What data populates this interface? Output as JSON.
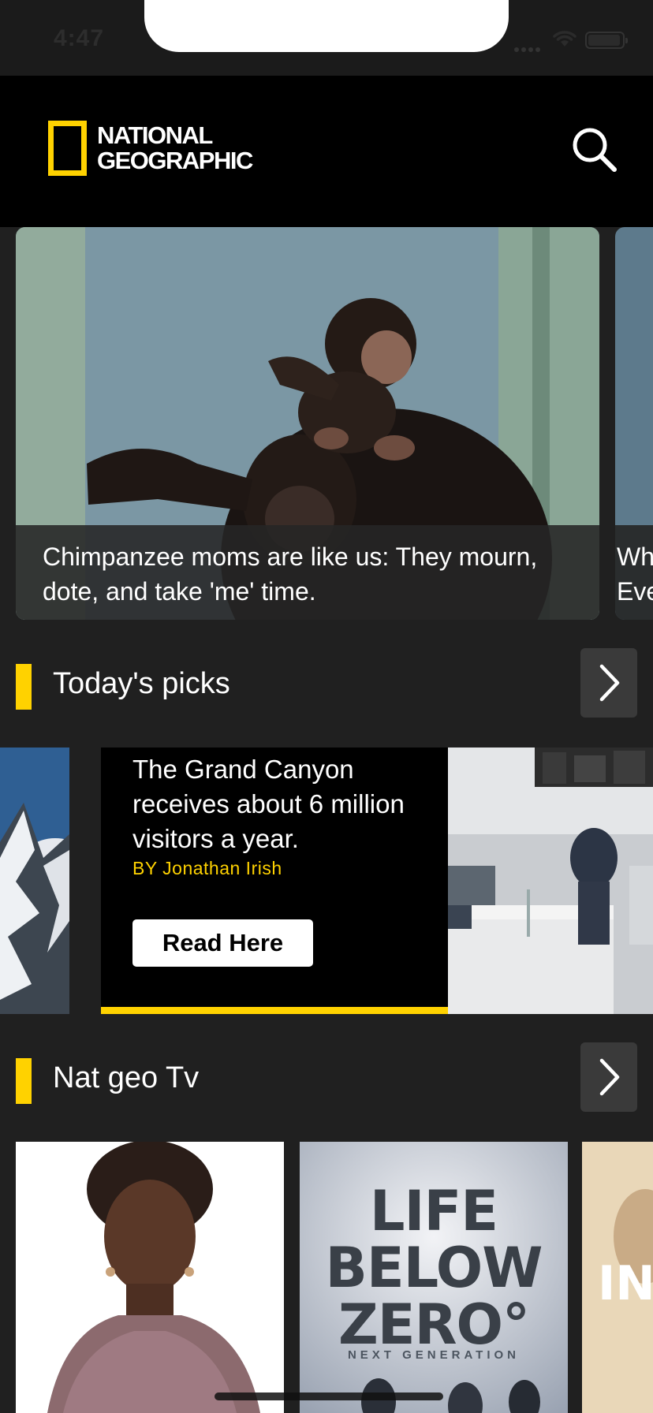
{
  "status_bar": {
    "time": "4:47"
  },
  "header": {
    "logo_line1": "NATIONAL",
    "logo_line2": "GEOGRAPHIC",
    "accent_color": "#ffd200"
  },
  "hero": {
    "items": [
      {
        "caption": "Chimpanzee moms are like us: They mourn, dote, and take 'me' time."
      },
      {
        "caption_line1": "Wh",
        "caption_line2": "Eve"
      }
    ]
  },
  "sections": {
    "todays_picks": {
      "title": "Today's picks"
    },
    "nat_geo_tv": {
      "title": "Nat geo Tv"
    }
  },
  "picks": {
    "card": {
      "title": "The Grand Canyon receives about 6 million visitors a year.",
      "byline": "BY Jonathan Irish",
      "button_label": "Read Here",
      "progress": 1.0
    }
  },
  "tv": {
    "posters": [
      {
        "name": "portrait"
      },
      {
        "line1": "LIFE",
        "line2": "BELOW",
        "line3": "ZERO°",
        "subtitle": "NEXT GENERATION"
      },
      {
        "name": "partial"
      }
    ]
  }
}
